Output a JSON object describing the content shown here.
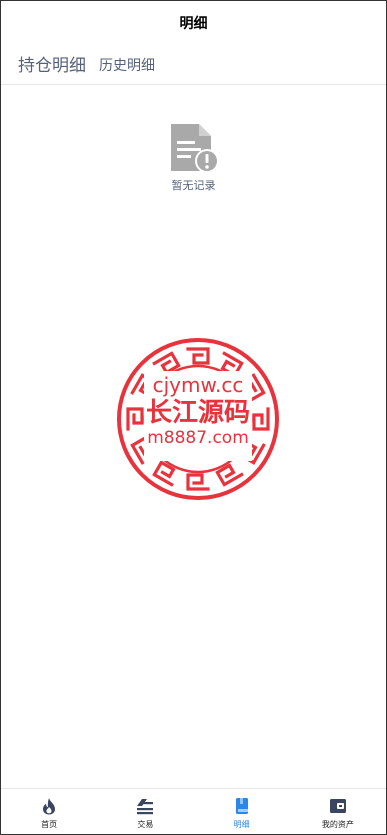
{
  "header": {
    "title": "明细"
  },
  "tabs": [
    {
      "label": "持仓明细",
      "active": true
    },
    {
      "label": "历史明细",
      "active": false
    }
  ],
  "empty_state": {
    "icon": "document-alert-icon",
    "text": "暂无记录"
  },
  "watermark": {
    "line1": "cjymw.cc",
    "line2": "长江源码",
    "line3": "m8887.com",
    "color": "#e8323c"
  },
  "tabbar": [
    {
      "label": "首页",
      "icon": "flame-icon",
      "active": false
    },
    {
      "label": "交易",
      "icon": "trade-icon",
      "active": false
    },
    {
      "label": "明细",
      "icon": "book-icon",
      "active": true
    },
    {
      "label": "我的资产",
      "icon": "wallet-icon",
      "active": false
    }
  ],
  "colors": {
    "active": "#2a86e8",
    "icon_dark": "#3a4660",
    "tab_text": "#55627a"
  }
}
